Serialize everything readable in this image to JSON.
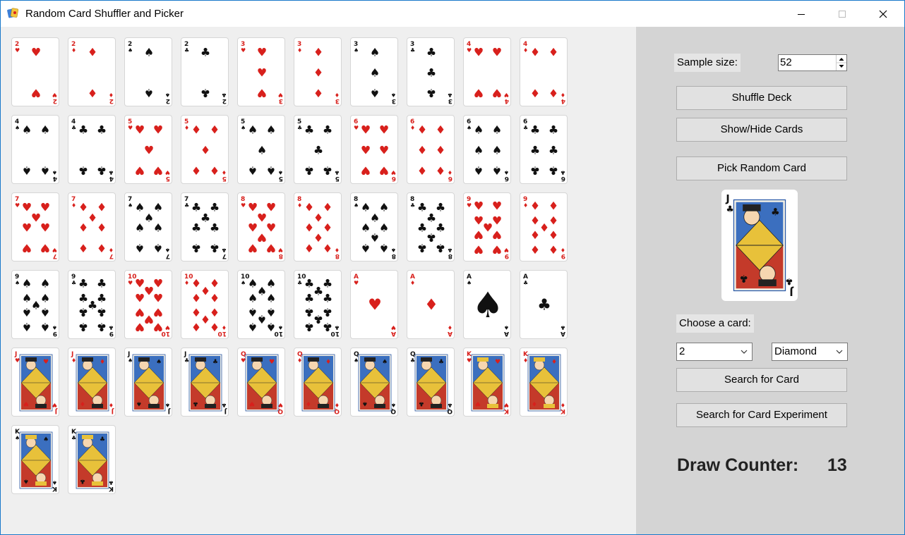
{
  "window": {
    "title": "Random Card Shuffler and Picker",
    "icons": [
      "app-icon",
      "minimize-icon",
      "maximize-icon",
      "close-icon"
    ]
  },
  "colors": {
    "red": "#d8201c",
    "black": "#111111",
    "panel_left": "#efefef",
    "panel_right": "#d4d4d4"
  },
  "deck": [
    {
      "rank": "2",
      "suit": "hearts"
    },
    {
      "rank": "2",
      "suit": "diamonds"
    },
    {
      "rank": "2",
      "suit": "spades"
    },
    {
      "rank": "2",
      "suit": "clubs"
    },
    {
      "rank": "3",
      "suit": "hearts"
    },
    {
      "rank": "3",
      "suit": "diamonds"
    },
    {
      "rank": "3",
      "suit": "spades"
    },
    {
      "rank": "3",
      "suit": "clubs"
    },
    {
      "rank": "4",
      "suit": "hearts"
    },
    {
      "rank": "4",
      "suit": "diamonds"
    },
    {
      "rank": "4",
      "suit": "spades"
    },
    {
      "rank": "4",
      "suit": "clubs"
    },
    {
      "rank": "5",
      "suit": "hearts"
    },
    {
      "rank": "5",
      "suit": "diamonds"
    },
    {
      "rank": "5",
      "suit": "spades"
    },
    {
      "rank": "5",
      "suit": "clubs"
    },
    {
      "rank": "6",
      "suit": "hearts"
    },
    {
      "rank": "6",
      "suit": "diamonds"
    },
    {
      "rank": "6",
      "suit": "spades"
    },
    {
      "rank": "6",
      "suit": "clubs"
    },
    {
      "rank": "7",
      "suit": "hearts"
    },
    {
      "rank": "7",
      "suit": "diamonds"
    },
    {
      "rank": "7",
      "suit": "spades"
    },
    {
      "rank": "7",
      "suit": "clubs"
    },
    {
      "rank": "8",
      "suit": "hearts"
    },
    {
      "rank": "8",
      "suit": "diamonds"
    },
    {
      "rank": "8",
      "suit": "spades"
    },
    {
      "rank": "8",
      "suit": "clubs"
    },
    {
      "rank": "9",
      "suit": "hearts"
    },
    {
      "rank": "9",
      "suit": "diamonds"
    },
    {
      "rank": "9",
      "suit": "spades"
    },
    {
      "rank": "9",
      "suit": "clubs"
    },
    {
      "rank": "10",
      "suit": "hearts"
    },
    {
      "rank": "10",
      "suit": "diamonds"
    },
    {
      "rank": "10",
      "suit": "spades"
    },
    {
      "rank": "10",
      "suit": "clubs"
    },
    {
      "rank": "A",
      "suit": "hearts"
    },
    {
      "rank": "A",
      "suit": "diamonds"
    },
    {
      "rank": "A",
      "suit": "spades"
    },
    {
      "rank": "A",
      "suit": "clubs"
    },
    {
      "rank": "J",
      "suit": "hearts"
    },
    {
      "rank": "J",
      "suit": "diamonds"
    },
    {
      "rank": "J",
      "suit": "spades"
    },
    {
      "rank": "J",
      "suit": "clubs"
    },
    {
      "rank": "Q",
      "suit": "hearts"
    },
    {
      "rank": "Q",
      "suit": "diamonds"
    },
    {
      "rank": "Q",
      "suit": "spades"
    },
    {
      "rank": "Q",
      "suit": "clubs"
    },
    {
      "rank": "K",
      "suit": "hearts"
    },
    {
      "rank": "K",
      "suit": "diamonds"
    },
    {
      "rank": "K",
      "suit": "spades"
    },
    {
      "rank": "K",
      "suit": "clubs"
    }
  ],
  "controls": {
    "sample_size_label": "Sample size:",
    "sample_size_value": "52",
    "shuffle_button": "Shuffle Deck",
    "show_hide_button": "Show/Hide Cards",
    "pick_button": "Pick Random Card",
    "picked_card": {
      "rank": "J",
      "suit": "clubs"
    },
    "choose_label": "Choose a card:",
    "rank_select_value": "2",
    "suit_select_value": "Diamond",
    "search_button": "Search for Card",
    "search_experiment_button": "Search for Card Experiment",
    "draw_counter_label": "Draw Counter:",
    "draw_counter_value": "13"
  }
}
